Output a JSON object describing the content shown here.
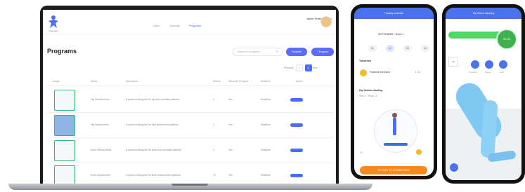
{
  "laptop": {
    "brand": "physioapp",
    "nav_items": [
      "Users",
      "Journals",
      "Programs"
    ],
    "active_nav": "Programs",
    "user_name": "Jamie Smith, Physio",
    "user_subtitle": "Physio",
    "page_title": "Programs",
    "search_placeholder": "Search for programs",
    "buttons": {
      "template": "Template",
      "program": "+ Program"
    },
    "pagination": {
      "previous": "Previous",
      "pages": [
        "1",
        "2"
      ],
      "active_page": "1",
      "next": "Next"
    },
    "columns": [
      "Image",
      "Name",
      "Description",
      "Weeks",
      "Standard Program",
      "Deadline",
      "Action"
    ],
    "rows": [
      {
        "name": "Hip Stretch/Arms",
        "description": "A protocol designed for hip and shoulder patients",
        "weeks": "1",
        "standard": "Yes",
        "deadline": "Deadline"
      },
      {
        "name": "Hip replacement",
        "description": "A protocol designed for hip replacement patients",
        "weeks": "1",
        "standard": "Yes",
        "deadline": "Deadline"
      },
      {
        "name": "Knee Stretch/Arms",
        "description": "A protocol designed for knee and shoulder patients",
        "weeks": "1",
        "standard": "Yes",
        "deadline": "Deadline"
      },
      {
        "name": "Knee replacement",
        "description": "A protocol designed for knee replacement patients",
        "weeks": "12",
        "standard": "Yes",
        "deadline": "Deadline"
      }
    ]
  },
  "phone_left": {
    "header_title": "Training schedule",
    "date_label": "SEPTEMBER - Week 1",
    "day_chips": [
      "01",
      "02",
      "03",
      "04"
    ],
    "active_chip": "02",
    "section_title": "Tomorrow",
    "progress_label": "Finished exercises",
    "progress_value": "0 of 6",
    "exercise_title": "Hip flexion standing",
    "exercise_subtitle": "Sets 3 / Reps 10",
    "footer_count": "10",
    "cta_label": "RETURN TO CONNECTION"
  },
  "phone_right": {
    "header_title": "Hip flexion standing",
    "timer_value": "01:30",
    "side_label": "10",
    "buttons": [
      "Previous",
      "Pause",
      "Next"
    ]
  }
}
